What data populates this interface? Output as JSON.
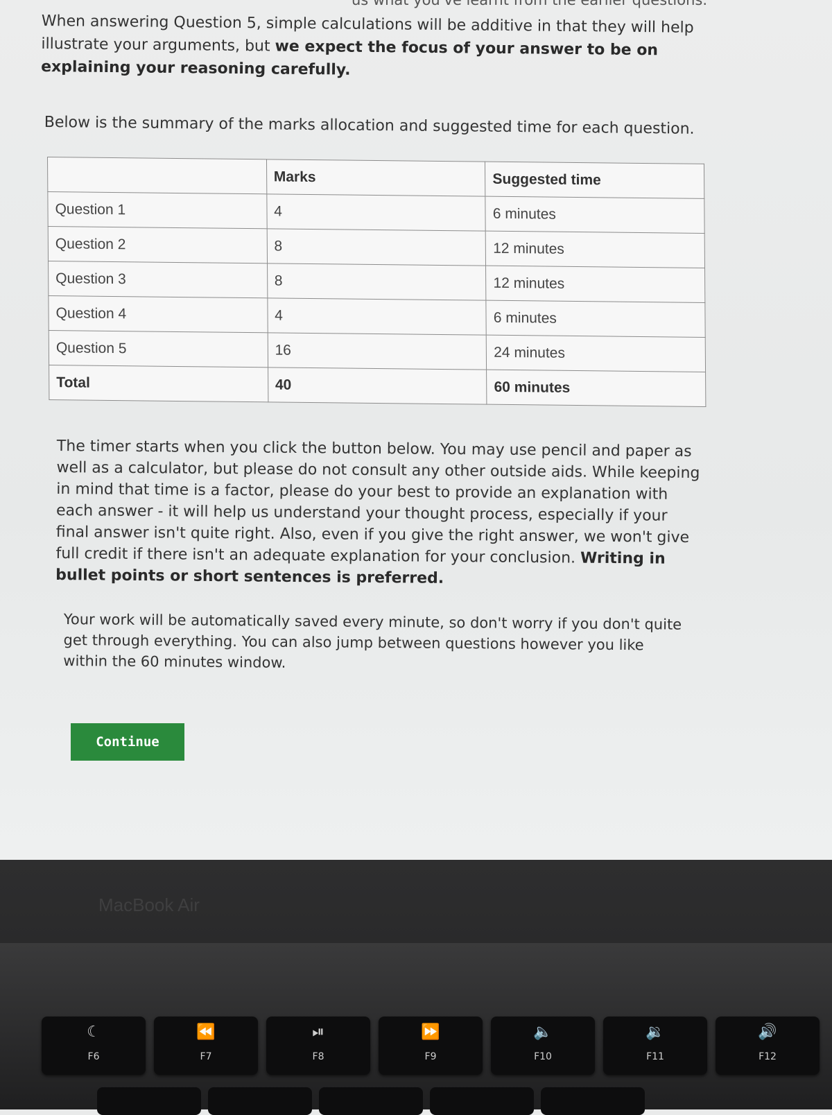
{
  "header_cut": "us what you've learnt from the earlier questions.",
  "intro": {
    "normal": "When answering Question 5, simple calculations will be additive in that they will help illustrate your arguments, but ",
    "bold": "we expect the focus of your answer to be on explaining your reasoning carefully."
  },
  "summary_text": "Below is the summary of the marks allocation and suggested time for each question.",
  "table": {
    "headers": [
      "",
      "Marks",
      "Suggested time"
    ],
    "rows": [
      {
        "q": "Question 1",
        "marks": "4",
        "time": "6 minutes"
      },
      {
        "q": "Question 2",
        "marks": "8",
        "time": "12 minutes"
      },
      {
        "q": "Question 3",
        "marks": "8",
        "time": "12 minutes"
      },
      {
        "q": "Question 4",
        "marks": "4",
        "time": "6 minutes"
      },
      {
        "q": "Question 5",
        "marks": "16",
        "time": "24 minutes"
      },
      {
        "q": "Total",
        "marks": "40",
        "time": "60 minutes"
      }
    ]
  },
  "timer_text": {
    "normal": "The timer starts when you click the button below. You may use pencil and paper as well as a calculator, but please do not consult any other outside aids. While keeping in mind that time is a factor, please do your best to provide an explanation with each answer - it will help us understand your thought process, especially if your final answer isn't quite right. Also, even if you give the right answer, we won't give full credit if there isn't an adequate explanation for your conclusion. ",
    "bold": "Writing in bullet points or short sentences is preferred."
  },
  "autosave_text": "Your work will be automatically saved every minute, so don't worry if you don't quite get through everything. You can also jump between questions however you like within the 60 minutes window.",
  "continue_label": "Continue",
  "brand": "MacBook Air",
  "keys": [
    {
      "glyph": "☾",
      "label": "F6",
      "icon": "do-not-disturb-icon"
    },
    {
      "glyph": "⏪",
      "label": "F7",
      "icon": "rewind-icon"
    },
    {
      "glyph": "⏯",
      "label": "F8",
      "icon": "play-pause-icon"
    },
    {
      "glyph": "⏩",
      "label": "F9",
      "icon": "fast-forward-icon"
    },
    {
      "glyph": "🔈",
      "label": "F10",
      "icon": "mute-icon"
    },
    {
      "glyph": "🔉",
      "label": "F11",
      "icon": "volume-down-icon"
    },
    {
      "glyph": "🔊",
      "label": "F12",
      "icon": "volume-up-icon"
    }
  ],
  "colors": {
    "continue_button": "#2a8a3c",
    "bezel": "#2e2e2f",
    "page_bg": "#e9eaea"
  }
}
